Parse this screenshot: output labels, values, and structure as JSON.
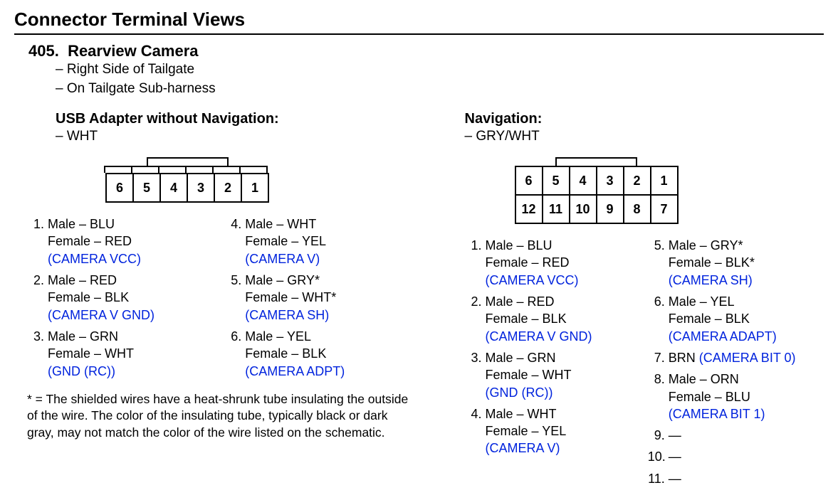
{
  "title": "Connector Terminal Views",
  "section": {
    "num": "405.",
    "name": "Rearview Camera",
    "loc1": "– Right Side of Tailgate",
    "loc2": "– On Tailgate Sub-harness"
  },
  "left": {
    "title": "USB Adapter without Navigation:",
    "color": "– WHT",
    "pins": {
      "p1_male": "Male – BLU",
      "p1_female": "Female – RED",
      "p1_sig": "(CAMERA VCC)",
      "p2_male": "Male – RED",
      "p2_female": "Female – BLK",
      "p2_sig": "(CAMERA V GND)",
      "p3_male": "Male – GRN",
      "p3_female": "Female – WHT",
      "p3_sig": "(GND (RC))",
      "p4_male": "Male – WHT",
      "p4_female": "Female – YEL",
      "p4_sig": "(CAMERA V)",
      "p5_male": "Male – GRY*",
      "p5_female": "Female – WHT*",
      "p5_sig": "(CAMERA SH)",
      "p6_male": "Male – YEL",
      "p6_female": "Female – BLK",
      "p6_sig": "(CAMERA ADPT)"
    },
    "cells": {
      "c1": "6",
      "c2": "5",
      "c3": "4",
      "c4": "3",
      "c5": "2",
      "c6": "1"
    }
  },
  "right": {
    "title": "Navigation:",
    "color": "– GRY/WHT",
    "pins": {
      "p1_male": "Male – BLU",
      "p1_female": "Female – RED",
      "p1_sig": "(CAMERA VCC)",
      "p2_male": "Male – RED",
      "p2_female": "Female – BLK",
      "p2_sig": "(CAMERA V GND)",
      "p3_male": "Male – GRN",
      "p3_female": "Female – WHT",
      "p3_sig": "(GND (RC))",
      "p4_male": "Male – WHT",
      "p4_female": "Female – YEL",
      "p4_sig": "(CAMERA V)",
      "p5_male": "Male – GRY*",
      "p5_female": "Female – BLK*",
      "p5_sig": "(CAMERA SH)",
      "p6_male": "Male – YEL",
      "p6_female": "Female – BLK",
      "p6_sig": "(CAMERA ADAPT)",
      "p7_wire": "BRN",
      "p7_sig": "(CAMERA BIT 0)",
      "p8_male": "Male – ORN",
      "p8_female": "Female – BLU",
      "p8_sig": "(CAMERA BIT 1)",
      "p9": "—",
      "p10": "—",
      "p11": "—"
    },
    "cells_r1": {
      "c1": "6",
      "c2": "5",
      "c3": "4",
      "c4": "3",
      "c5": "2",
      "c6": "1"
    },
    "cells_r2": {
      "c1": "12",
      "c2": "11",
      "c3": "10",
      "c4": "9",
      "c5": "8",
      "c6": "7"
    }
  },
  "footnote": "* = The shielded wires have a heat-shrunk tube insulating the outside of the wire. The color of the insulating tube, typically black or dark gray, may not match the color of the wire listed on the schematic."
}
